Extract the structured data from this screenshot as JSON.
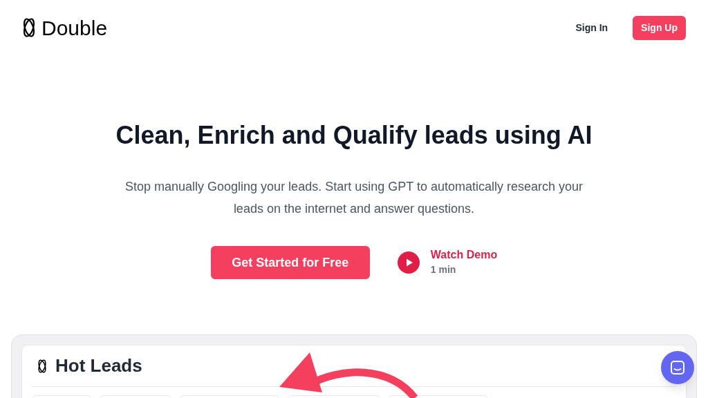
{
  "nav": {
    "brand": "Double",
    "links": [
      {
        "label": "Sign In",
        "kind": "link"
      },
      {
        "label": "Sign Up",
        "kind": "primary"
      }
    ]
  },
  "hero": {
    "title": "Clean, Enrich and Qualify leads using AI",
    "subtitle": "Stop manually Googling your leads. Start using GPT to automatically research your leads on the internet and answer questions.",
    "cta": "Get Started for Free",
    "demo": {
      "label": "Watch Demo",
      "duration": "1 min"
    }
  },
  "preview": {
    "title": "Hot Leads"
  }
}
